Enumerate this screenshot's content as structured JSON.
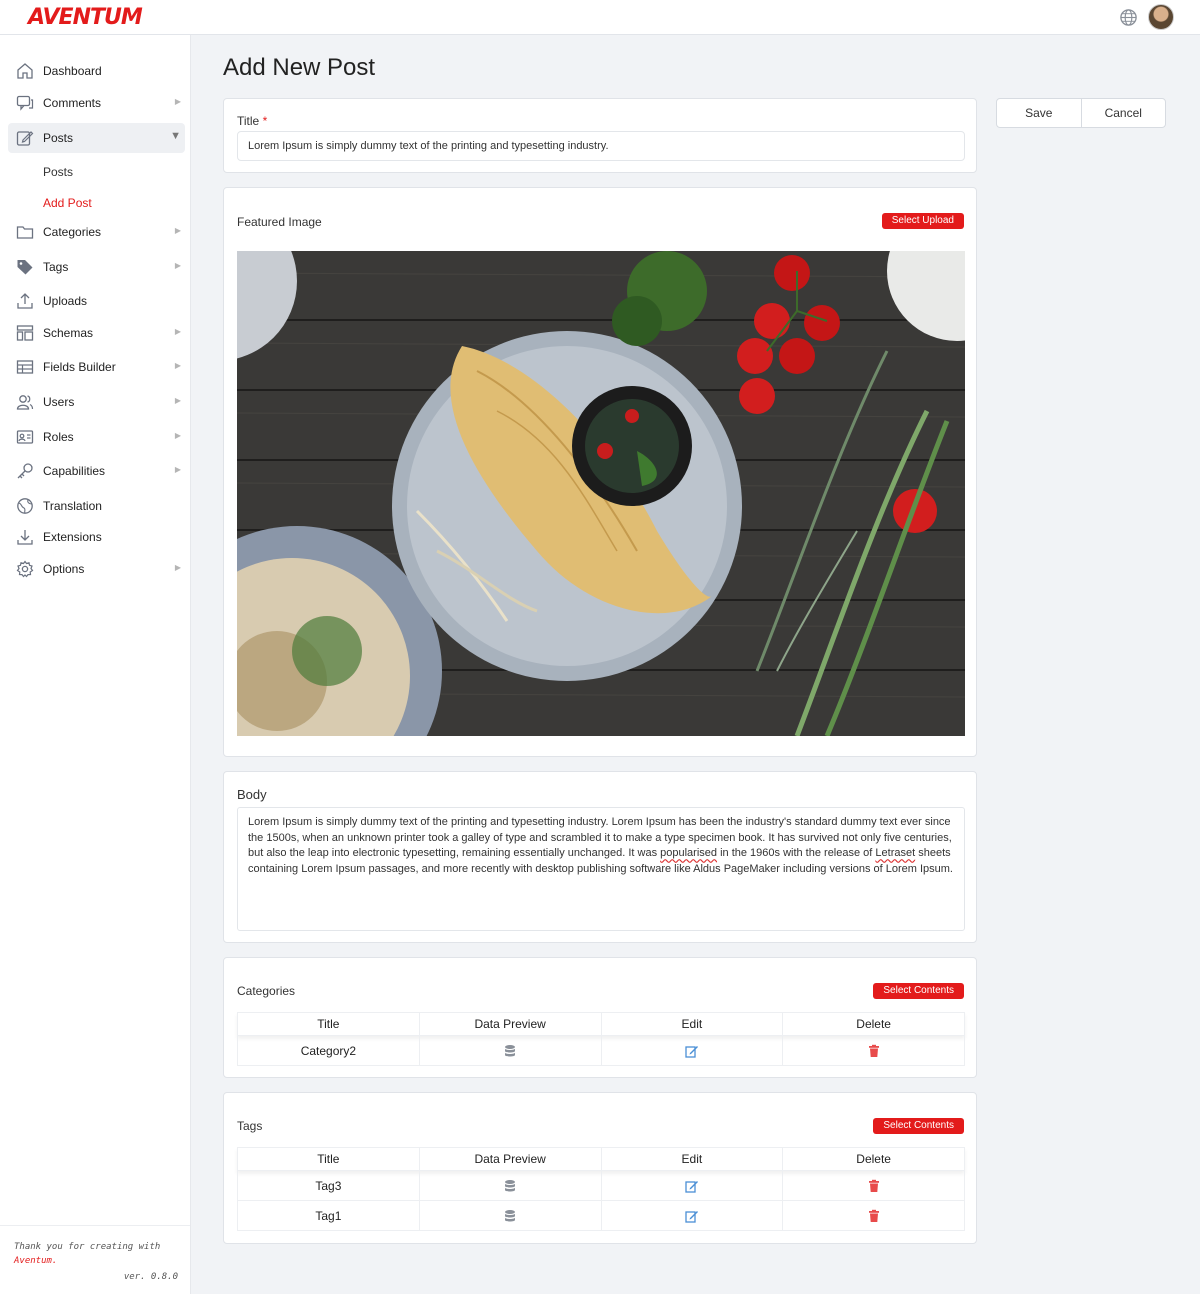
{
  "app": {
    "logo": "AVENTUM"
  },
  "header": {
    "globe_icon": "globe-icon",
    "avatar_icon": "user-avatar"
  },
  "sidebar": {
    "items": [
      {
        "label": "Dashboard",
        "icon": "home-icon",
        "has_arrow": false
      },
      {
        "label": "Comments",
        "icon": "comments-icon",
        "has_arrow": true
      },
      {
        "label": "Posts",
        "icon": "edit-icon",
        "has_arrow": true,
        "expanded": true
      },
      {
        "label": "Categories",
        "icon": "folder-icon",
        "has_arrow": true
      },
      {
        "label": "Tags",
        "icon": "tag-icon",
        "has_arrow": true
      },
      {
        "label": "Uploads",
        "icon": "upload-icon",
        "has_arrow": false
      },
      {
        "label": "Schemas",
        "icon": "layout-icon",
        "has_arrow": true
      },
      {
        "label": "Fields Builder",
        "icon": "table-icon",
        "has_arrow": true
      },
      {
        "label": "Users",
        "icon": "users-icon",
        "has_arrow": true
      },
      {
        "label": "Roles",
        "icon": "id-card-icon",
        "has_arrow": true
      },
      {
        "label": "Capabilities",
        "icon": "key-icon",
        "has_arrow": true
      },
      {
        "label": "Translation",
        "icon": "globe-icon",
        "has_arrow": false
      },
      {
        "label": "Extensions",
        "icon": "download-icon",
        "has_arrow": false
      },
      {
        "label": "Options",
        "icon": "gear-icon",
        "has_arrow": true
      }
    ],
    "sub_items": [
      {
        "label": "Posts",
        "active": false
      },
      {
        "label": "Add Post",
        "active": true
      }
    ],
    "footer": {
      "line1": "Thank you for creating with",
      "brand": "Aventum.",
      "version": "ver. 0.8.0"
    }
  },
  "page": {
    "title": "Add New Post"
  },
  "actions": {
    "save": "Save",
    "cancel": "Cancel"
  },
  "title_field": {
    "label": "Title",
    "required_mark": "*",
    "value": "Lorem Ipsum is simply dummy text of the printing and typesetting industry."
  },
  "featured_image": {
    "label": "Featured Image",
    "button": "Select Upload"
  },
  "body": {
    "label": "Body",
    "text_part1": "Lorem Ipsum is simply dummy text of the printing and typesetting industry. Lorem Ipsum has been the industry's standard dummy text ever since the 1500s, when an unknown printer took a galley of type and scrambled it to make a type specimen book. It has survived not only five centuries, but also the leap into electronic typesetting, remaining essentially unchanged. It was ",
    "text_word1": "popularised",
    "text_part2": " in the 1960s with the release of ",
    "text_word2": "Letraset",
    "text_part3": " sheets containing Lorem Ipsum passages, and more recently with desktop publishing software like Aldus PageMaker including versions of Lorem Ipsum."
  },
  "categories": {
    "label": "Categories",
    "button": "Select Contents",
    "columns": [
      "Title",
      "Data Preview",
      "Edit",
      "Delete"
    ],
    "rows": [
      {
        "title": "Category2"
      }
    ]
  },
  "tags": {
    "label": "Tags",
    "button": "Select Contents",
    "columns": [
      "Title",
      "Data Preview",
      "Edit",
      "Delete"
    ],
    "rows": [
      {
        "title": "Tag3"
      },
      {
        "title": "Tag1"
      }
    ]
  },
  "colors": {
    "accent": "#e31b1b",
    "edit": "#4a8fd6",
    "delete": "#e84b4b",
    "muted": "#8a9099"
  }
}
